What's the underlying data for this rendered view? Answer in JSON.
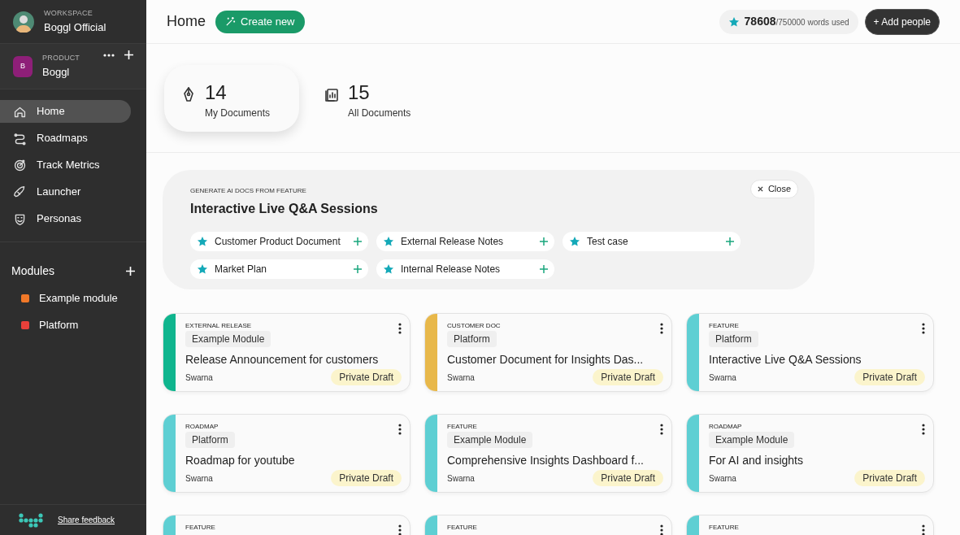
{
  "workspace": {
    "label": "WORKSPACE",
    "name": "Boggl Official"
  },
  "product": {
    "label": "PRODUCT",
    "initial": "B",
    "name": "Boggl"
  },
  "nav": [
    {
      "label": "Home",
      "kind": "home",
      "selected": true
    },
    {
      "label": "Roadmaps",
      "kind": "roadmap",
      "selected": false
    },
    {
      "label": "Track Metrics",
      "kind": "metrics",
      "selected": false
    },
    {
      "label": "Launcher",
      "kind": "launcher",
      "selected": false
    },
    {
      "label": "Personas",
      "kind": "personas",
      "selected": false
    }
  ],
  "modules": {
    "title": "Modules",
    "items": [
      {
        "label": "Example module",
        "color": "#f07828"
      },
      {
        "label": "Platform",
        "color": "#e8403a"
      }
    ]
  },
  "feedback": "Share feedback",
  "header": {
    "title": "Home",
    "create": "Create new",
    "words_used": "78608",
    "words_total": "/750000 words used",
    "add_people": "+ Add people"
  },
  "stats": [
    {
      "value": "14",
      "label": "My Documents",
      "kind": "mine",
      "selected": true
    },
    {
      "value": "15",
      "label": "All Documents",
      "kind": "all",
      "selected": false
    }
  ],
  "ai_panel": {
    "eyebrow": "GENERATE AI DOCS FROM FEATURE",
    "title": "Interactive Live Q&A Sessions",
    "close": "Close",
    "templates": [
      "Customer Product Document",
      "External Release Notes",
      "Test case",
      "Market Plan",
      "Internal Release Notes"
    ]
  },
  "cards": [
    {
      "type": "EXTERNAL RELEASE",
      "color": "#0fb58e",
      "module": "Example Module",
      "title": "Release Announcement for customers",
      "author": "Swarna",
      "status": "Private Draft"
    },
    {
      "type": "CUSTOMER DOC",
      "color": "#e8b84a",
      "module": "Platform",
      "title": "Customer Document for Insights Das...",
      "author": "Swarna",
      "status": "Private Draft"
    },
    {
      "type": "FEATURE",
      "color": "#5ecfd3",
      "module": "Platform",
      "title": "Interactive Live Q&A Sessions",
      "author": "Swarna",
      "status": "Private Draft"
    },
    {
      "type": "ROADMAP",
      "color": "#5ecfd3",
      "module": "Platform",
      "title": "Roadmap for youtube",
      "author": "Swarna",
      "status": "Private Draft"
    },
    {
      "type": "FEATURE",
      "color": "#5ecfd3",
      "module": "Example Module",
      "title": "Comprehensive Insights Dashboard f...",
      "author": "Swarna",
      "status": "Private Draft"
    },
    {
      "type": "ROADMAP",
      "color": "#5ecfd3",
      "module": "Example Module",
      "title": "For AI and insights",
      "author": "Swarna",
      "status": "Private Draft"
    },
    {
      "type": "FEATURE",
      "color": "#5ecfd3"
    },
    {
      "type": "FEATURE",
      "color": "#5ecfd3"
    },
    {
      "type": "FEATURE",
      "color": "#5ecfd3"
    }
  ]
}
